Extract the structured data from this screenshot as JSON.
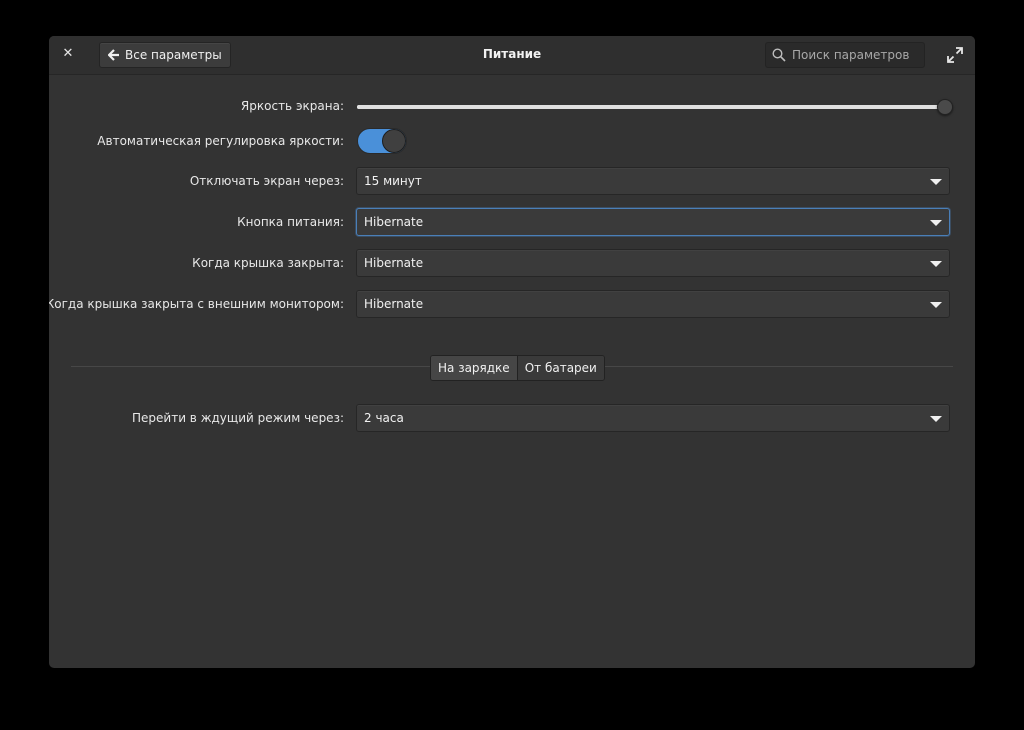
{
  "window": {
    "title": "Питание",
    "back_label": "Все параметры",
    "search_placeholder": "Поиск параметров"
  },
  "icons": {
    "close": "close-icon",
    "back": "arrow-left-icon",
    "search": "search-icon",
    "maximize": "maximize-icon",
    "dropdown": "chevron-down-icon"
  },
  "brightness": {
    "label": "Яркость экрана:",
    "value_fraction": 0.99
  },
  "auto_brightness": {
    "label": "Автоматическая регулировка яркости:",
    "enabled": true
  },
  "screen_off": {
    "label": "Отключать экран через:",
    "value": "15 минут"
  },
  "power_button": {
    "label": "Кнопка питания:",
    "value": "Hibernate"
  },
  "lid_closed": {
    "label": "Когда крышка закрыта:",
    "value": "Hibernate"
  },
  "lid_closed_external": {
    "label": "Когда крышка закрыта с внешним монитором:",
    "value": "Hibernate"
  },
  "power_tabs": {
    "charging": "На зарядке",
    "battery": "От батареи",
    "active": "charging"
  },
  "sleep": {
    "label": "Перейти в ждущий режим через:",
    "value": "2 часа"
  },
  "colors": {
    "accent": "#4a90d9",
    "window_bg": "#333333",
    "focus_border": "#4a7fb8"
  }
}
